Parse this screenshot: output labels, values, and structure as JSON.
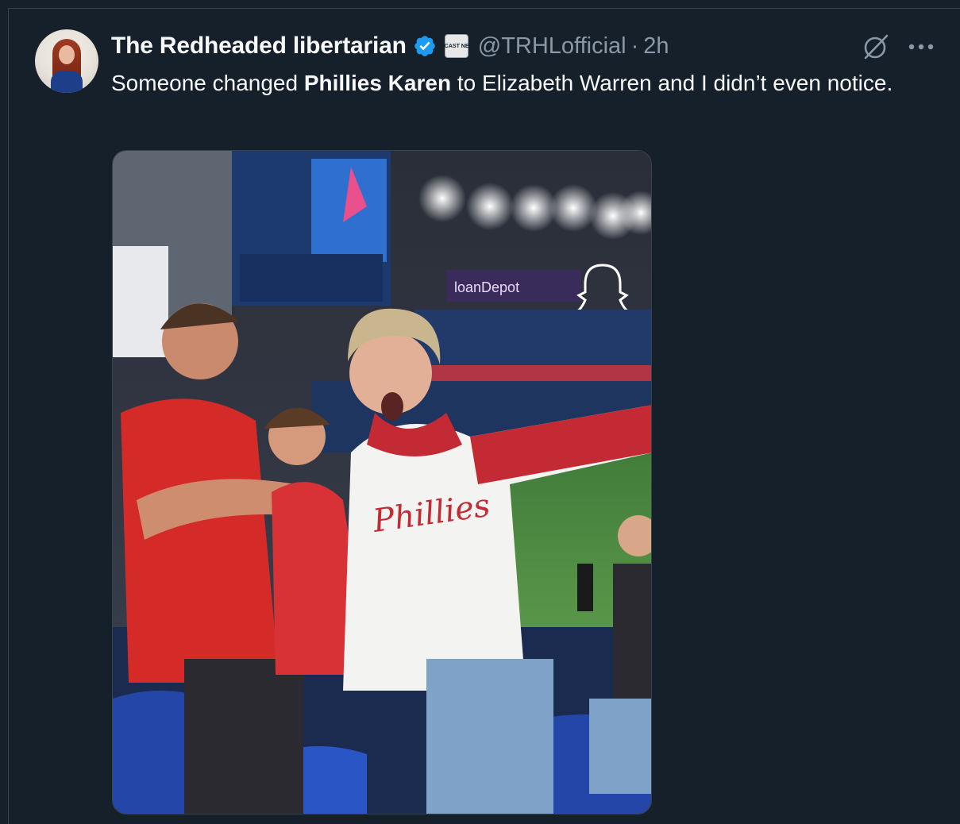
{
  "tweet": {
    "display_name": "The Redheaded libertarian",
    "verified": true,
    "affiliate_badge_text": "TIMCAST NEWS",
    "handle": "@TRHLofficial",
    "separator": "·",
    "time": "2h",
    "text_before": "Someone changed ",
    "text_bold": "Phillies Karen",
    "text_after": " to Elizabeth Warren and I didn’t even notice.",
    "media": {
      "scoreboard_text": "loanDepot",
      "shirt_text": "Phillies"
    }
  },
  "colors": {
    "background": "#15202b",
    "text_primary": "#f7f9f9",
    "text_secondary": "#8b98a5",
    "verified_blue": "#1d9bf0",
    "border": "#38444d"
  },
  "icons": {
    "verified": "verified-badge-icon",
    "grok": "grok-icon",
    "more": "more-dots-icon"
  }
}
